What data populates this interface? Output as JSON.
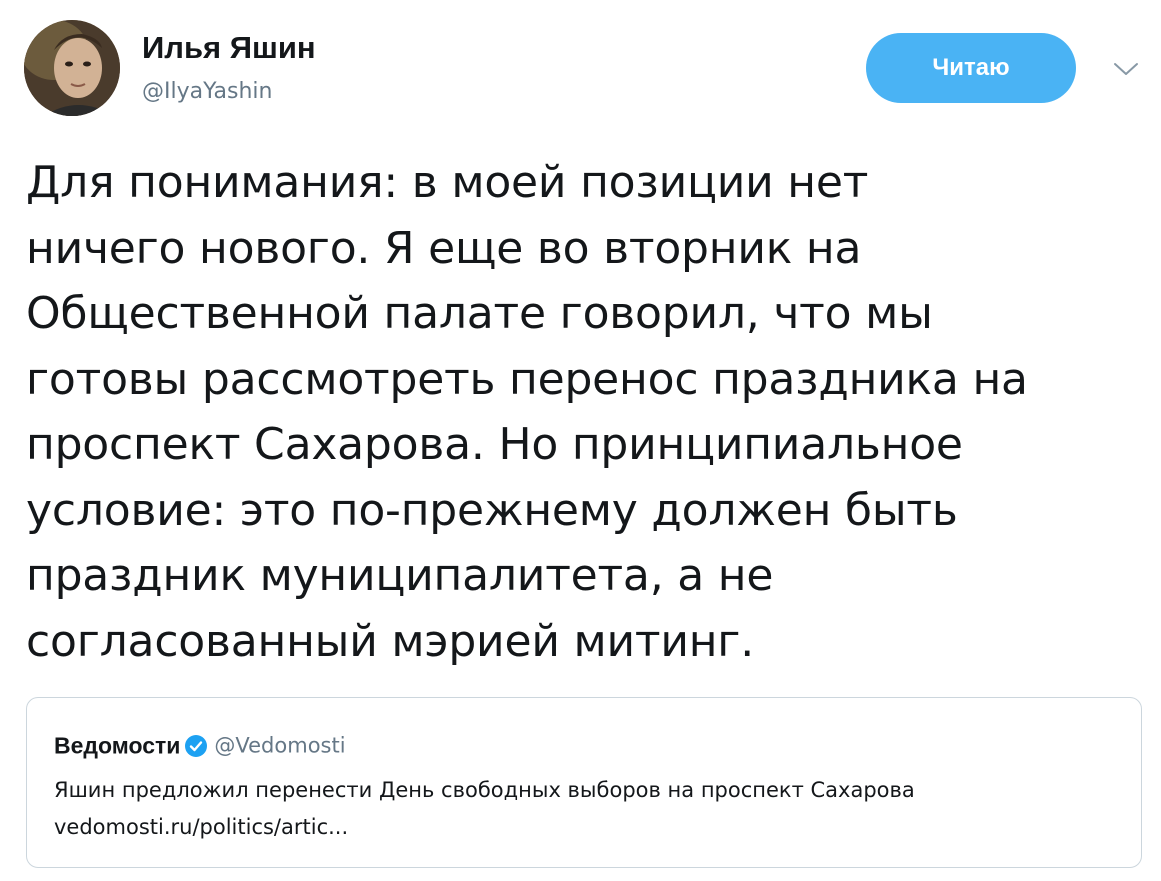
{
  "author": {
    "display_name": "Илья Яшин",
    "handle": "@IlyaYashin",
    "avatar_icon": "user-avatar-photo"
  },
  "actions": {
    "follow_label": "Читаю",
    "more_icon": "chevron-down-icon",
    "follow_color": "#4ab3f4"
  },
  "tweet": {
    "lines": [
      "Для понимания: в моей позиции нет",
      "ничего нового. Я еще во вторник на",
      "Общественной палате говорил, что мы",
      "готовы рассмотреть перенос праздника на",
      "проспект Сахарова. Но принципиальное",
      "условие: это по-прежнему должен быть",
      "праздник муниципалитета, а не",
      "согласованный мэрией митинг."
    ]
  },
  "quoted": {
    "name": "Ведомости",
    "verified_icon": "verified-badge-icon",
    "verified_color": "#1da1f2",
    "handle": "@Vedomosti",
    "text": "Яшин предложил перенести День свободных выборов на проспект Сахарова",
    "link": "vedomosti.ru/politics/artic..."
  }
}
